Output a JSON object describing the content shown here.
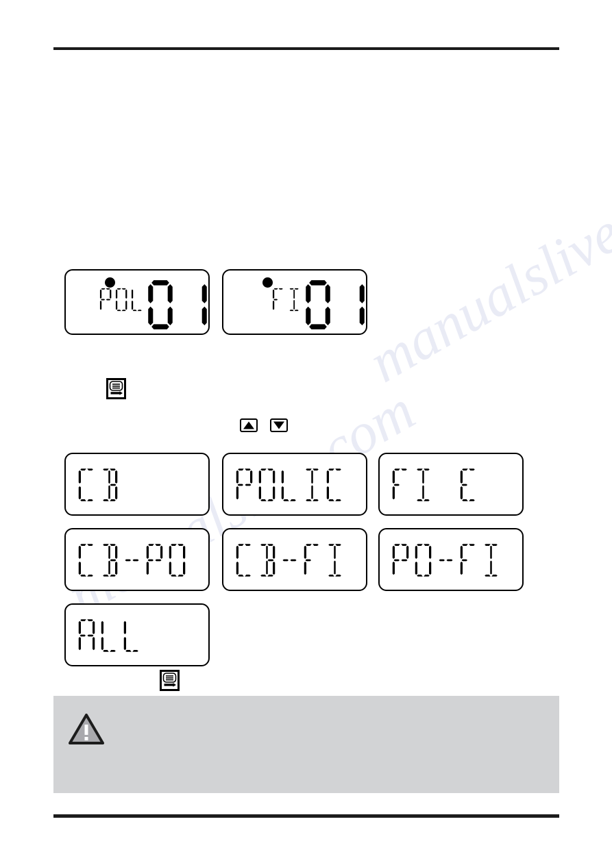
{
  "page": {
    "background_color": "#ffffff",
    "rule_color": "#1c1c1c",
    "note_box_color": "#d2d3d5",
    "segment_color": "#000000"
  },
  "watermark": {
    "text": "manualslive.com",
    "color": "#b9bfe0"
  },
  "status_displays": [
    {
      "name": "police-channel-display",
      "label_text": "POL",
      "value_text": "01",
      "indicator_dot": true
    },
    {
      "name": "fire-channel-display",
      "label_text": "FI",
      "value_text": "01",
      "indicator_dot": true
    }
  ],
  "menu_icon": {
    "name": "menu-lcd-icon",
    "label": "menu-icon"
  },
  "arrow_buttons": [
    {
      "name": "up-arrow-button",
      "glyph": "▲"
    },
    {
      "name": "down-arrow-button",
      "glyph": "▼"
    }
  ],
  "mode_displays": [
    {
      "name": "mode-cb",
      "text": "CB"
    },
    {
      "name": "mode-polic",
      "text": "POLIC"
    },
    {
      "name": "mode-fire",
      "text": "FIRE"
    },
    {
      "name": "mode-cb-po",
      "text": "CB-PO"
    },
    {
      "name": "mode-cb-fi",
      "text": "CB-FI"
    },
    {
      "name": "mode-po-fi",
      "text": "PO-FI"
    },
    {
      "name": "mode-all",
      "text": "ALL"
    }
  ],
  "note": {
    "icon": "warning-triangle-icon",
    "text": ""
  }
}
